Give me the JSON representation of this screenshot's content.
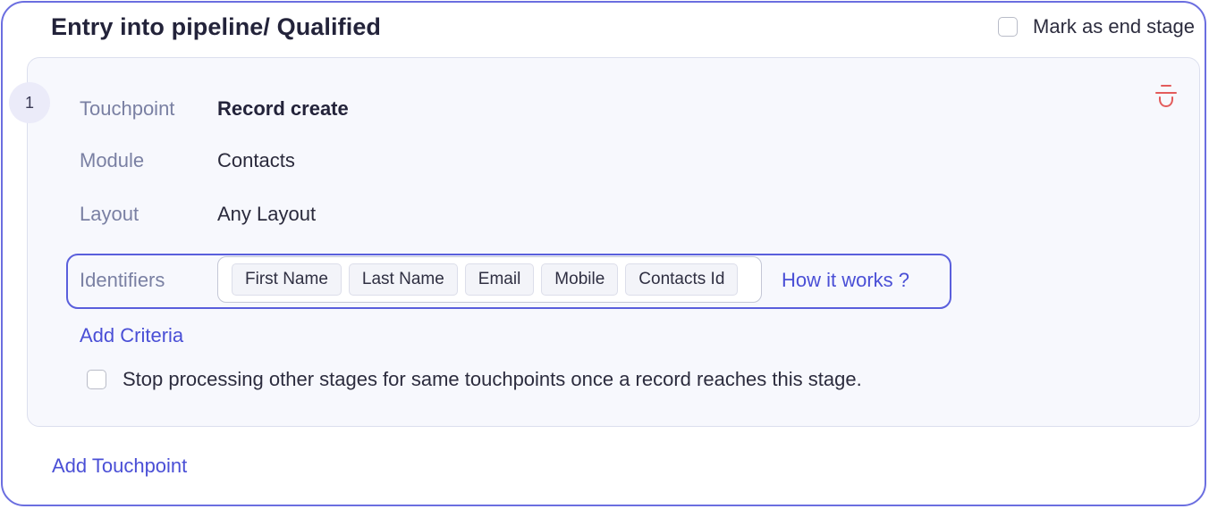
{
  "stage": {
    "title": "Entry into pipeline/ Qualified",
    "mark_end_stage_label": "Mark as end stage",
    "mark_end_stage_checked": false
  },
  "touchpoint": {
    "index": "1",
    "delete_icon": "trash-icon",
    "rows": {
      "touchpoint": {
        "label": "Touchpoint",
        "value": "Record create"
      },
      "module": {
        "label": "Module",
        "value": "Contacts"
      },
      "layout": {
        "label": "Layout",
        "value": "Any Layout"
      }
    },
    "identifiers": {
      "label": "Identifiers",
      "chips": [
        "First Name",
        "Last Name",
        "Email",
        "Mobile",
        "Contacts Id"
      ],
      "help_link": "How it works ?"
    },
    "add_criteria_label": "Add Criteria",
    "stop_processing_label": "Stop processing other stages for same touchpoints once a record reaches this stage.",
    "stop_processing_checked": false
  },
  "add_touchpoint_label": "Add Touchpoint",
  "colors": {
    "accent": "#4a4fd6",
    "border": "#6b6ee0",
    "delete": "#e35b5b",
    "panel_bg": "#f7f8fd"
  }
}
